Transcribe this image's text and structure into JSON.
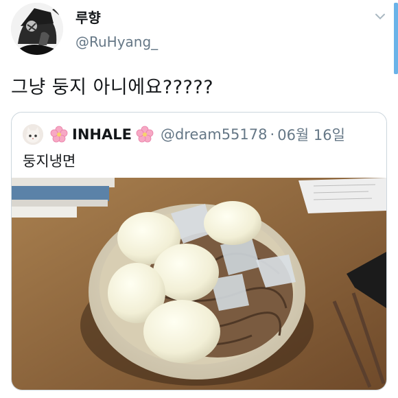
{
  "tweet": {
    "display_name": "루향",
    "handle": "@RuHyang_",
    "text": "그냥 둥지 아니에요?????"
  },
  "quote": {
    "name": "INHALE",
    "handle": "@dream55178",
    "separator": "·",
    "date": "06월 16일",
    "text": "둥지냉면"
  },
  "icons": {
    "avatar": "avatar-image",
    "caret": "chevron-down-icon",
    "flower": "cherry-blossom-emoji",
    "quote_avatar": "cat-avatar"
  },
  "colors": {
    "text": "#14171a",
    "secondary": "#657786",
    "border": "#ccd6dd",
    "accent": "#6ab3e8"
  }
}
